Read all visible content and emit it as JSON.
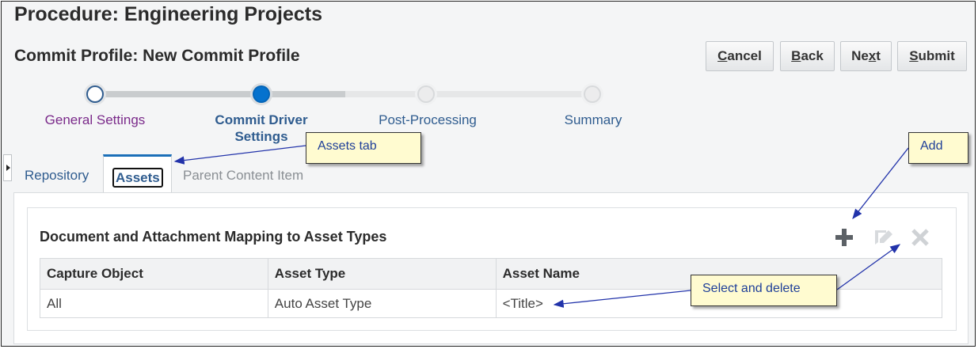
{
  "page": {
    "procedure_title": "Procedure: Engineering Projects",
    "commit_title": "Commit Profile: New Commit Profile"
  },
  "buttons": {
    "cancel": {
      "accesskey": "C",
      "rest": "ancel"
    },
    "back": {
      "accesskey": "B",
      "rest": "ack"
    },
    "next": {
      "pre": "Ne",
      "accesskey": "x",
      "rest": "t"
    },
    "submit": {
      "accesskey": "S",
      "rest": "ubmit"
    }
  },
  "train": {
    "steps": [
      {
        "label": "General Settings",
        "state": "visited"
      },
      {
        "label": "Commit Driver Settings",
        "state": "current"
      },
      {
        "label": "Post-Processing",
        "state": "disabled"
      },
      {
        "label": "Summary",
        "state": "disabled"
      }
    ]
  },
  "tabs": {
    "repository": "Repository",
    "assets": "Assets",
    "parent_content_item": "Parent Content Item"
  },
  "section": {
    "title": "Document and Attachment Mapping to Asset Types"
  },
  "table": {
    "columns": [
      "Capture Object",
      "Asset Type",
      "Asset Name"
    ],
    "rows": [
      [
        "All",
        "Auto Asset Type",
        "<Title>"
      ]
    ]
  },
  "toolbar": {
    "add_icon": "plus-icon",
    "edit_icon": "pencil-icon",
    "delete_icon": "x-icon"
  },
  "callouts": {
    "assets_tab": "Assets tab",
    "add": "Add",
    "select_delete": "Select and delete"
  },
  "colors": {
    "visited_link": "#7a2a8a",
    "current_link": "#2f5c8f",
    "disabled": "#8a8f94",
    "train_current": "#0572ce",
    "callout_bg": "#fffbd0",
    "callout_text": "#1f3f99"
  }
}
